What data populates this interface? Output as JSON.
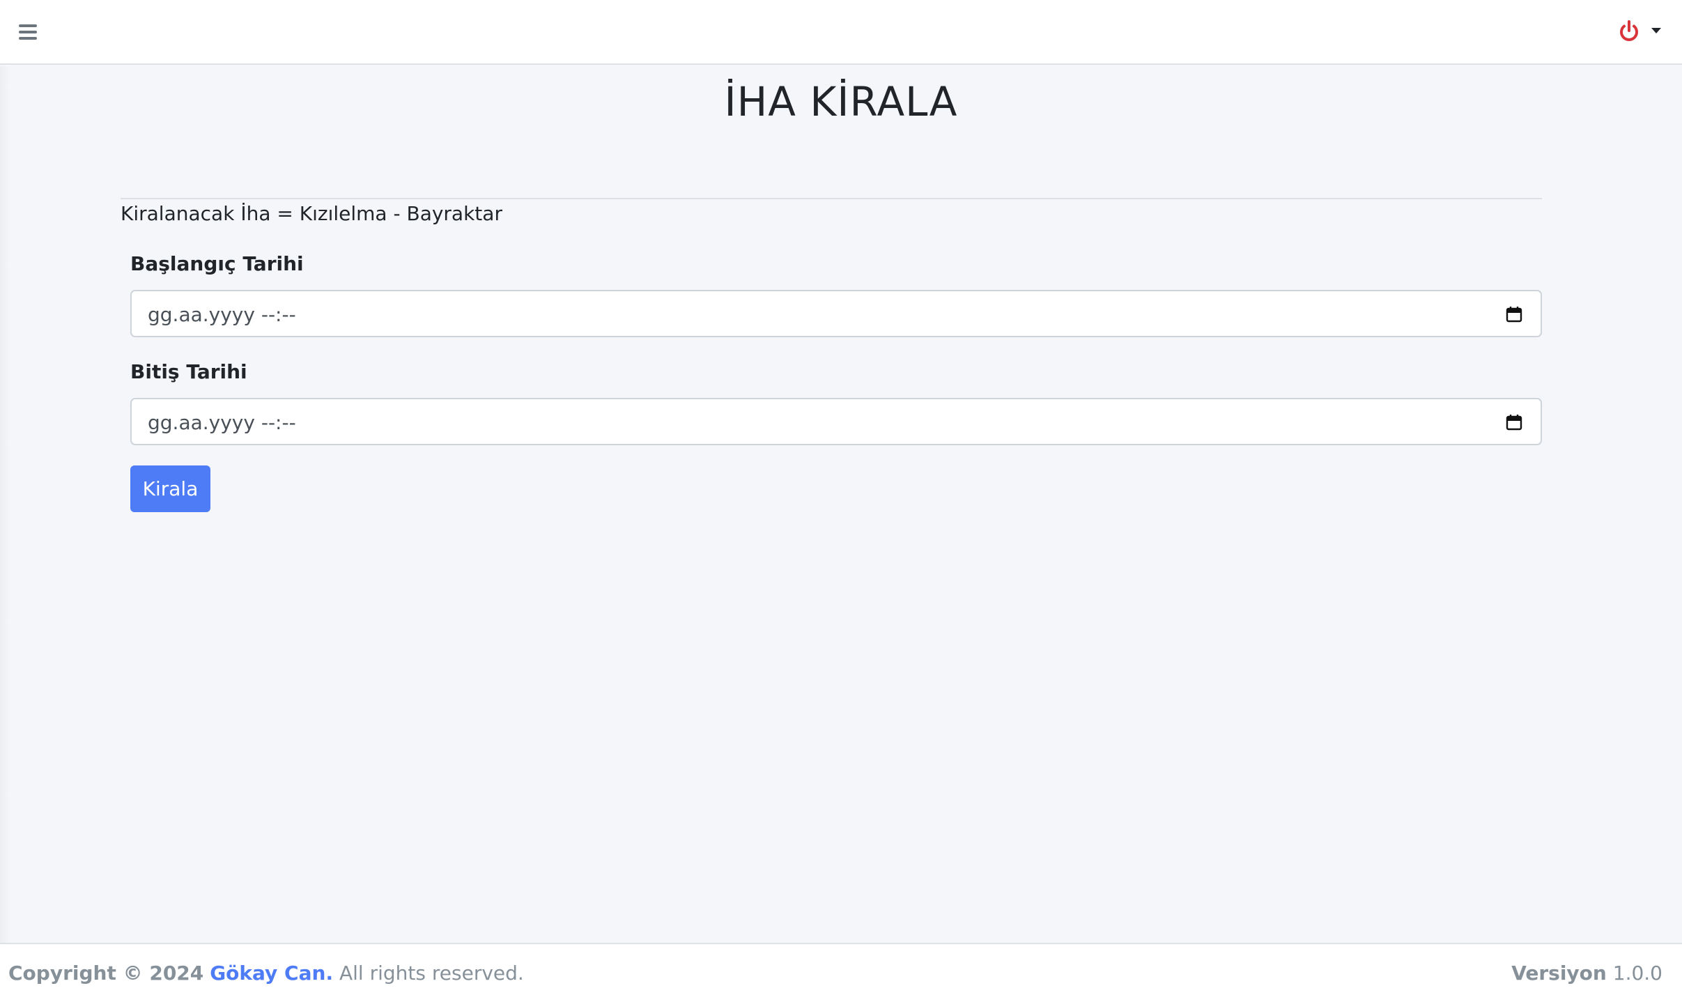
{
  "navbar": {
    "menu_icon": "hamburger-menu-icon",
    "user_icon": "power-icon",
    "user_icon_color": "#d9343a",
    "dropdown_icon": "caret-down-icon"
  },
  "main": {
    "title": "İHA KİRALA",
    "rental_info": "Kiralanacak İha = Kızılelma - Bayraktar",
    "form": {
      "start_label": "Başlangıç Tarihi",
      "start_value": "gg.aa.yyyy --:--",
      "end_label": "Bitiş Tarihi",
      "end_value": "gg.aa.yyyy --:--",
      "calendar_icon": "calendar-icon",
      "submit_label": "Kirala",
      "submit_color": "#4e7cf6"
    }
  },
  "footer": {
    "copyright_prefix": "Copyright © 2024",
    "author": "Gökay Can.",
    "rights": "All rights reserved.",
    "version_label": "Versiyon",
    "version": "1.0.0",
    "link_color": "#4e7cf6"
  }
}
